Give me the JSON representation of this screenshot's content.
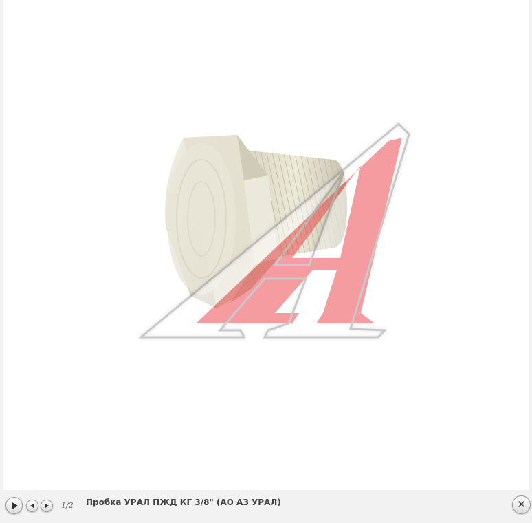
{
  "image": {
    "subject": "product-photo-plug",
    "watermark_icon": "letter-a-logo-icon",
    "watermark_color": "#e8262c"
  },
  "controls": {
    "play_icon": "play-icon",
    "prev_icon": "arrow-left-icon",
    "next_icon": "arrow-right-icon",
    "close_icon": "close-icon",
    "close_glyph": "✕",
    "counter": "1/2"
  },
  "caption": {
    "text": "Пробка УРАЛ ПЖД КГ 3/8\" (АО АЗ УРАЛ)"
  }
}
